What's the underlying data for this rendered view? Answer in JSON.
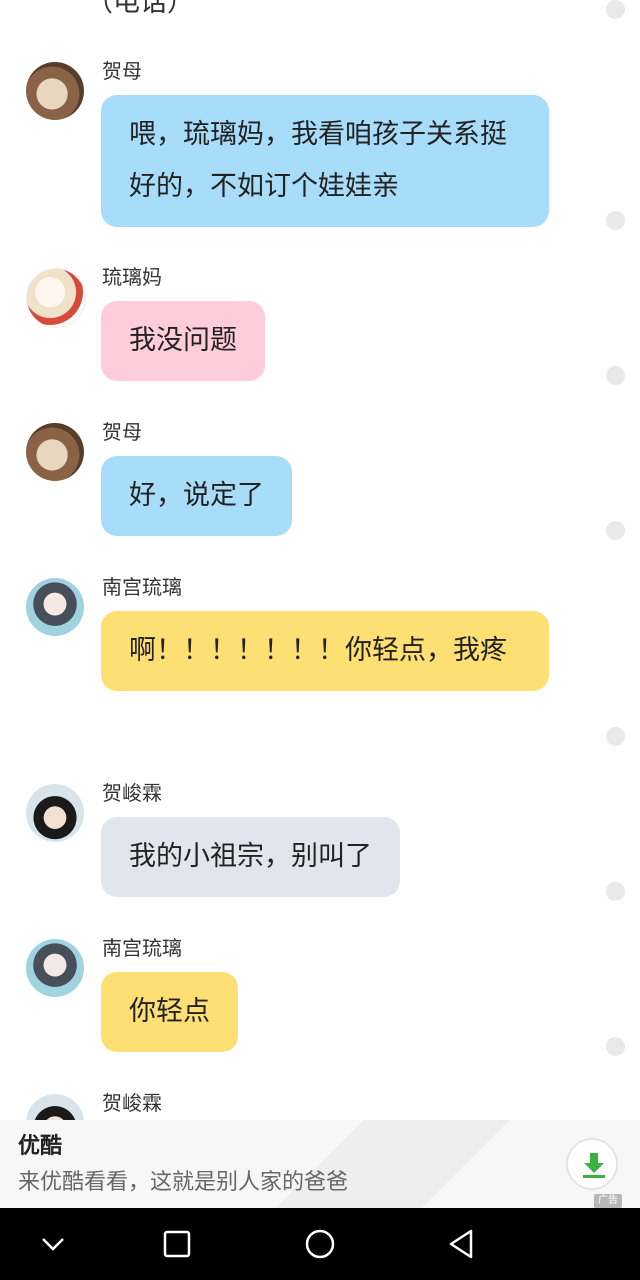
{
  "chat": {
    "top_fragment": "（电话）",
    "messages": [
      {
        "sender": "贺母",
        "text": "喂，琉璃妈，我看咱孩子关系挺好的，不如订个娃娃亲"
      },
      {
        "sender": "琉璃妈",
        "text": "我没问题"
      },
      {
        "sender": "贺母",
        "text": "好，说定了"
      },
      {
        "sender": "南宫琉璃",
        "text": "啊！！！！！！！你轻点，我疼"
      },
      {
        "sender": "贺峻霖",
        "text": "我的小祖宗，别叫了"
      },
      {
        "sender": "南宫琉璃",
        "text": "你轻点"
      },
      {
        "sender": "贺峻霖",
        "text": ""
      }
    ]
  },
  "ad": {
    "title": "优酷",
    "description": "来优酷看看，这就是别人家的爸爸",
    "badge": "广告",
    "download_icon": "download-icon"
  },
  "colors": {
    "blue_bubble": "#a8ddfa",
    "pink_bubble": "#fdcddc",
    "yellow_bubble": "#fddf73",
    "gray_bubble": "#e1e6ee",
    "download_green": "#3cb043"
  },
  "navbar": {
    "icons": [
      "chevron-down-icon",
      "square-icon",
      "circle-icon",
      "back-triangle-icon"
    ]
  }
}
